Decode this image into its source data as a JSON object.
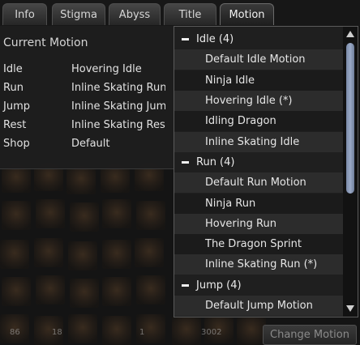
{
  "tabs": [
    {
      "label": "Info"
    },
    {
      "label": "Stigma"
    },
    {
      "label": "Abyss"
    },
    {
      "label": "Title"
    },
    {
      "label": "Motion"
    }
  ],
  "active_tab": "Motion",
  "current_motion": {
    "title": "Current Motion",
    "rows": [
      {
        "label": "Idle",
        "value": "Hovering Idle"
      },
      {
        "label": "Run",
        "value": "Inline Skating Run"
      },
      {
        "label": "Jump",
        "value": "Inline Skating Jump"
      },
      {
        "label": "Rest",
        "value": "Inline Skating Rest"
      },
      {
        "label": "Shop",
        "value": "Default"
      }
    ]
  },
  "motion_list": [
    {
      "type": "group",
      "text": "Idle (4)"
    },
    {
      "type": "item",
      "text": "Default Idle Motion"
    },
    {
      "type": "item",
      "text": "Ninja Idle"
    },
    {
      "type": "item",
      "text": "Hovering Idle (*)"
    },
    {
      "type": "item",
      "text": "Idling Dragon"
    },
    {
      "type": "item",
      "text": "Inline Skating Idle"
    },
    {
      "type": "group",
      "text": "Run (4)"
    },
    {
      "type": "item",
      "text": "Default Run Motion"
    },
    {
      "type": "item",
      "text": "Ninja Run"
    },
    {
      "type": "item",
      "text": "Hovering Run"
    },
    {
      "type": "item",
      "text": "The Dragon Sprint"
    },
    {
      "type": "item",
      "text": "Inline Skating Run (*)"
    },
    {
      "type": "group",
      "text": "Jump (4)"
    },
    {
      "type": "item",
      "text": "Default Jump Motion"
    }
  ],
  "change_button": {
    "label": "Change Motion"
  },
  "background_counts": [
    "86",
    "18",
    "1",
    "3002"
  ],
  "icons": {
    "group_toggle": "minus-icon",
    "scroll_up": "triangle-up-icon",
    "scroll_down": "triangle-down-icon"
  }
}
